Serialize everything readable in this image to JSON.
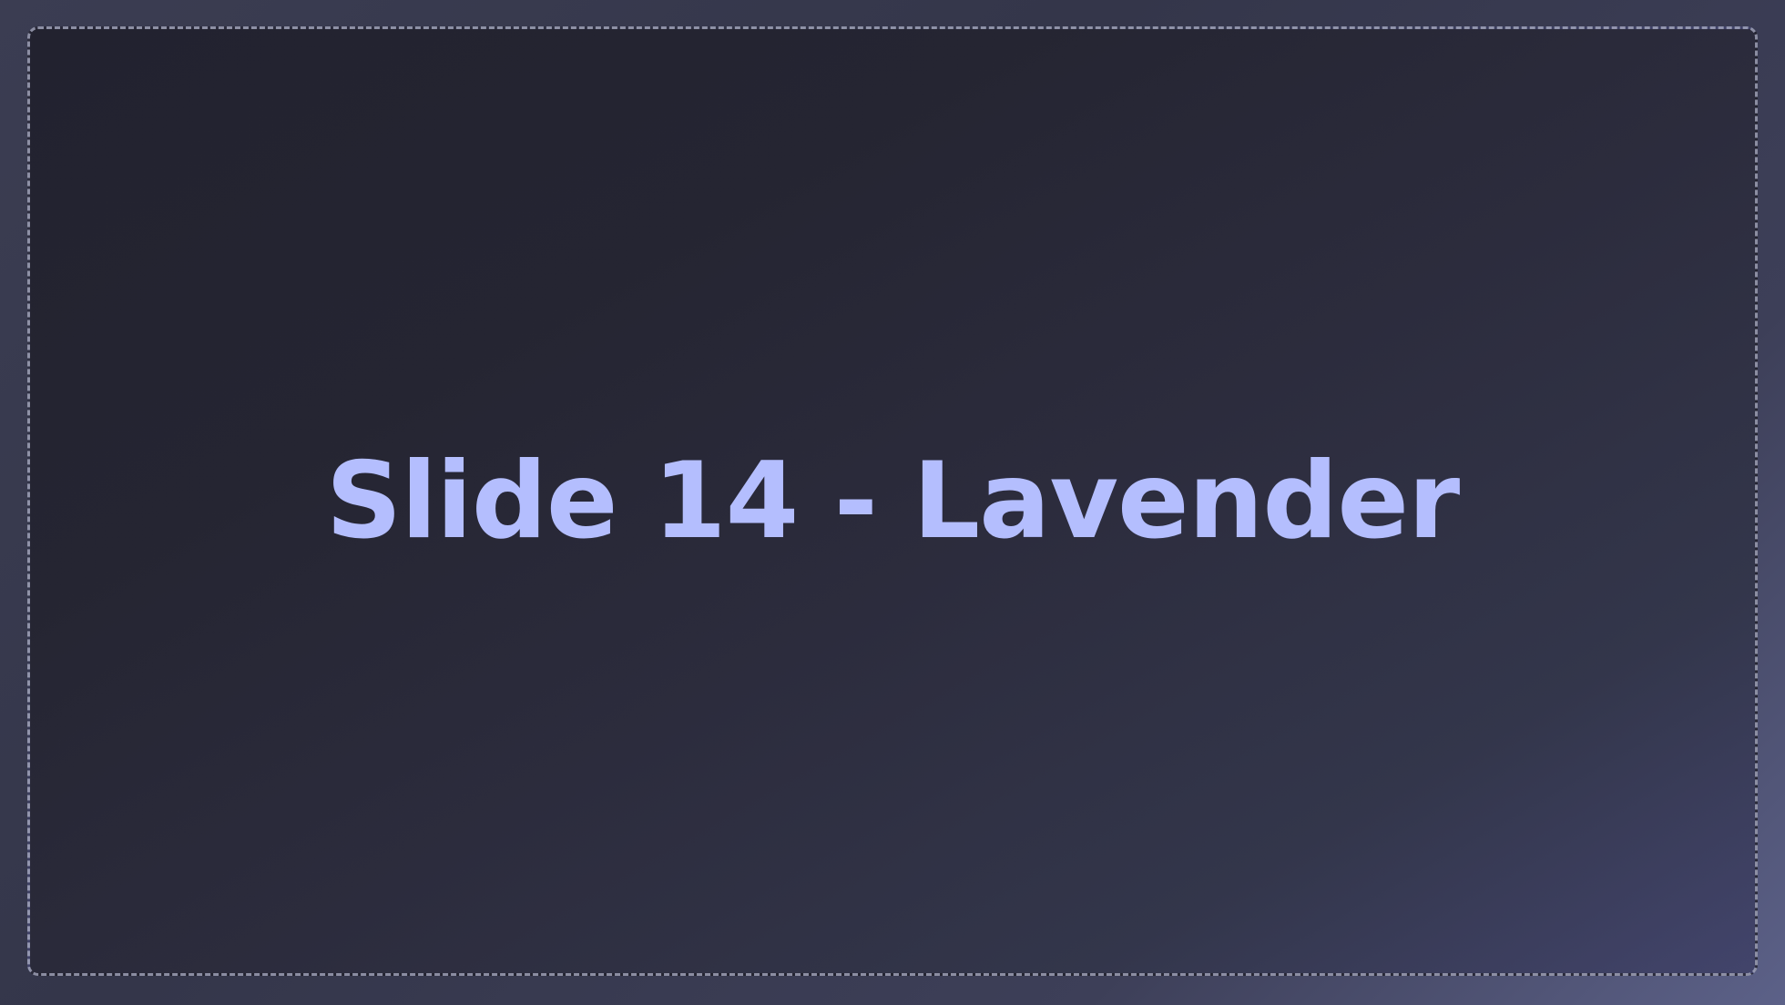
{
  "slide": {
    "title": "Slide 14 - Lavender",
    "title_color": "#b4befe",
    "background_color": "#262631",
    "frame_border_color": "#a9acc4"
  }
}
